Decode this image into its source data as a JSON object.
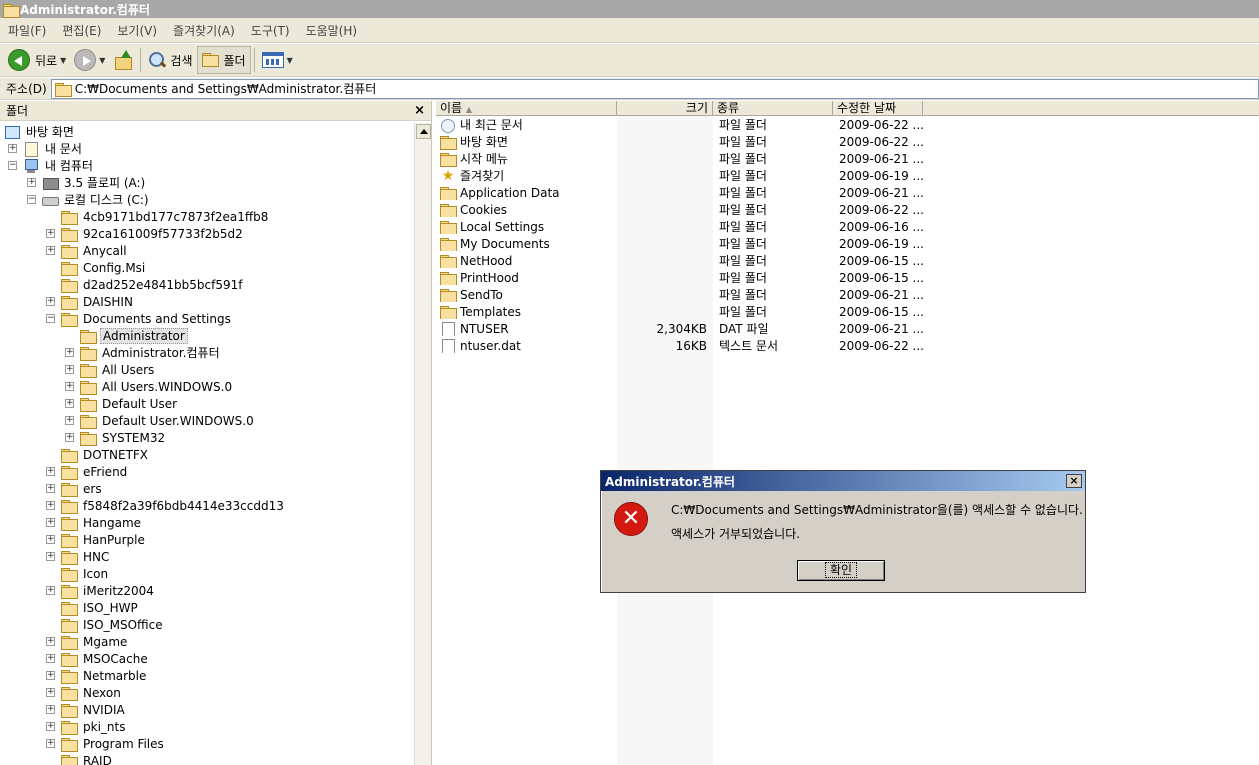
{
  "window": {
    "title": "Administrator.컴퓨터"
  },
  "menu": [
    "파일(F)",
    "편집(E)",
    "보기(V)",
    "즐겨찾기(A)",
    "도구(T)",
    "도움말(H)"
  ],
  "toolbar": {
    "back_label": "뒤로",
    "search_label": "검색",
    "folders_label": "폴더"
  },
  "address": {
    "label": "주소(D)",
    "value": "C:₩Documents and Settings₩Administrator.컴퓨터"
  },
  "folder_pane": {
    "title": "폴더",
    "close": "×",
    "tree": [
      {
        "label": "바탕 화면",
        "level": 0,
        "expander": "",
        "icon": "desktop"
      },
      {
        "label": "내 문서",
        "level": 1,
        "expander": "+",
        "icon": "docs"
      },
      {
        "label": "내 컴퓨터",
        "level": 1,
        "expander": "−",
        "icon": "computer"
      },
      {
        "label": "3.5 플로피 (A:)",
        "level": 2,
        "expander": "+",
        "icon": "floppy"
      },
      {
        "label": "로컬 디스크 (C:)",
        "level": 2,
        "expander": "−",
        "icon": "drive"
      },
      {
        "label": "4cb9171bd177c7873f2ea1ffb8",
        "level": 3,
        "expander": "",
        "icon": "folder"
      },
      {
        "label": "92ca161009f57733f2b5d2",
        "level": 3,
        "expander": "+",
        "icon": "folder"
      },
      {
        "label": "Anycall",
        "level": 3,
        "expander": "+",
        "icon": "folder"
      },
      {
        "label": "Config.Msi",
        "level": 3,
        "expander": "",
        "icon": "folder"
      },
      {
        "label": "d2ad252e4841bb5bcf591f",
        "level": 3,
        "expander": "",
        "icon": "folder"
      },
      {
        "label": "DAISHIN",
        "level": 3,
        "expander": "+",
        "icon": "folder"
      },
      {
        "label": "Documents and Settings",
        "level": 3,
        "expander": "−",
        "icon": "folder"
      },
      {
        "label": "Administrator",
        "level": 4,
        "expander": "",
        "icon": "folder",
        "selected": true
      },
      {
        "label": "Administrator.컴퓨터",
        "level": 4,
        "expander": "+",
        "icon": "folder"
      },
      {
        "label": "All Users",
        "level": 4,
        "expander": "+",
        "icon": "folder"
      },
      {
        "label": "All Users.WINDOWS.0",
        "level": 4,
        "expander": "+",
        "icon": "folder"
      },
      {
        "label": "Default User",
        "level": 4,
        "expander": "+",
        "icon": "folder"
      },
      {
        "label": "Default User.WINDOWS.0",
        "level": 4,
        "expander": "+",
        "icon": "folder"
      },
      {
        "label": "SYSTEM32",
        "level": 4,
        "expander": "+",
        "icon": "folder"
      },
      {
        "label": "DOTNETFX",
        "level": 3,
        "expander": "",
        "icon": "folder"
      },
      {
        "label": "eFriend",
        "level": 3,
        "expander": "+",
        "icon": "folder"
      },
      {
        "label": "ers",
        "level": 3,
        "expander": "+",
        "icon": "folder"
      },
      {
        "label": "f5848f2a39f6bdb4414e33ccdd13",
        "level": 3,
        "expander": "+",
        "icon": "folder"
      },
      {
        "label": "Hangame",
        "level": 3,
        "expander": "+",
        "icon": "folder"
      },
      {
        "label": "HanPurple",
        "level": 3,
        "expander": "+",
        "icon": "folder"
      },
      {
        "label": "HNC",
        "level": 3,
        "expander": "+",
        "icon": "folder"
      },
      {
        "label": "Icon",
        "level": 3,
        "expander": "",
        "icon": "folder"
      },
      {
        "label": "iMeritz2004",
        "level": 3,
        "expander": "+",
        "icon": "folder"
      },
      {
        "label": "ISO_HWP",
        "level": 3,
        "expander": "",
        "icon": "folder"
      },
      {
        "label": "ISO_MSOffice",
        "level": 3,
        "expander": "",
        "icon": "folder"
      },
      {
        "label": "Mgame",
        "level": 3,
        "expander": "+",
        "icon": "folder"
      },
      {
        "label": "MSOCache",
        "level": 3,
        "expander": "+",
        "icon": "folder"
      },
      {
        "label": "Netmarble",
        "level": 3,
        "expander": "+",
        "icon": "folder"
      },
      {
        "label": "Nexon",
        "level": 3,
        "expander": "+",
        "icon": "folder"
      },
      {
        "label": "NVIDIA",
        "level": 3,
        "expander": "+",
        "icon": "folder"
      },
      {
        "label": "pki_nts",
        "level": 3,
        "expander": "+",
        "icon": "folder"
      },
      {
        "label": "Program Files",
        "level": 3,
        "expander": "+",
        "icon": "folder"
      },
      {
        "label": "RAID",
        "level": 3,
        "expander": "",
        "icon": "folder"
      }
    ]
  },
  "list": {
    "columns": [
      "이름",
      "크기",
      "종류",
      "수정한 날짜"
    ],
    "rows": [
      {
        "name": "내 최근 문서",
        "size": "",
        "type": "파일 폴더",
        "date": "2009-06-22 ...",
        "icon": "recent"
      },
      {
        "name": "바탕 화면",
        "size": "",
        "type": "파일 폴더",
        "date": "2009-06-22 ...",
        "icon": "folder"
      },
      {
        "name": "시작 메뉴",
        "size": "",
        "type": "파일 폴더",
        "date": "2009-06-21 ...",
        "icon": "folder"
      },
      {
        "name": "즐겨찾기",
        "size": "",
        "type": "파일 폴더",
        "date": "2009-06-19 ...",
        "icon": "star"
      },
      {
        "name": "Application Data",
        "size": "",
        "type": "파일 폴더",
        "date": "2009-06-21 ...",
        "icon": "folder"
      },
      {
        "name": "Cookies",
        "size": "",
        "type": "파일 폴더",
        "date": "2009-06-22 ...",
        "icon": "folder"
      },
      {
        "name": "Local Settings",
        "size": "",
        "type": "파일 폴더",
        "date": "2009-06-16 ...",
        "icon": "folder"
      },
      {
        "name": "My Documents",
        "size": "",
        "type": "파일 폴더",
        "date": "2009-06-19 ...",
        "icon": "folder"
      },
      {
        "name": "NetHood",
        "size": "",
        "type": "파일 폴더",
        "date": "2009-06-15 ...",
        "icon": "folder"
      },
      {
        "name": "PrintHood",
        "size": "",
        "type": "파일 폴더",
        "date": "2009-06-15 ...",
        "icon": "folder"
      },
      {
        "name": "SendTo",
        "size": "",
        "type": "파일 폴더",
        "date": "2009-06-21 ...",
        "icon": "folder"
      },
      {
        "name": "Templates",
        "size": "",
        "type": "파일 폴더",
        "date": "2009-06-15 ...",
        "icon": "folder"
      },
      {
        "name": "NTUSER",
        "size": "2,304KB",
        "type": "DAT 파일",
        "date": "2009-06-21 ...",
        "icon": "file"
      },
      {
        "name": "ntuser.dat",
        "size": "16KB",
        "type": "텍스트 문서",
        "date": "2009-06-22 ...",
        "icon": "file"
      }
    ]
  },
  "dialog": {
    "title": "Administrator.컴퓨터",
    "close": "×",
    "icon_glyph": "✕",
    "message1": "C:₩Documents and Settings₩Administrator을(를) 액세스할 수 없습니다.",
    "message2": "액세스가 거부되었습니다.",
    "ok_label": "확인"
  }
}
